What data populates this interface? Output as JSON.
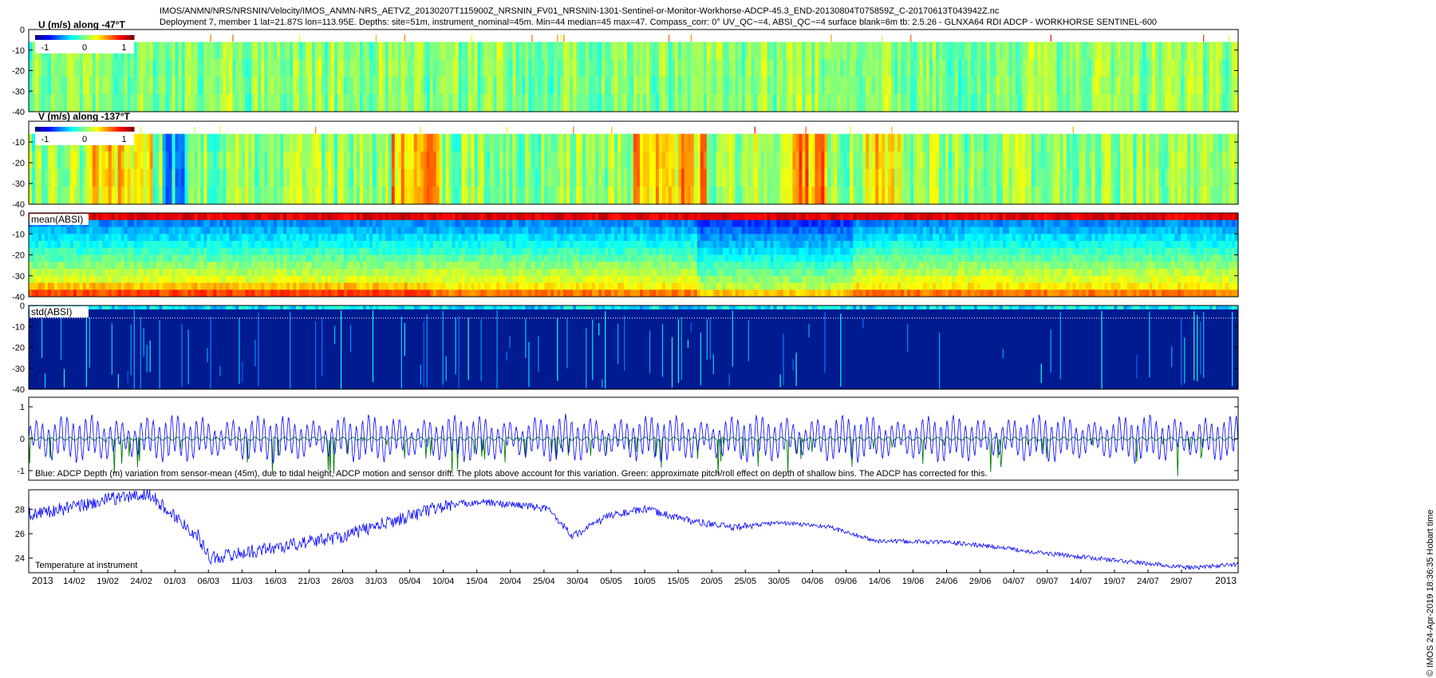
{
  "header": {
    "line1": "IMOS/ANMN/NRS/NRSNIN/Velocity/IMOS_ANMN-NRS_AETVZ_20130207T115900Z_NRSNIN_FV01_NRSNIN-1301-Sentinel-or-Monitor-Workhorse-ADCP-45.3_END-20130804T075859Z_C-20170613T043942Z.nc",
    "line2": "Deployment 7, member 1 lat=21.87S lon=113.95E. Depths: site=51m, instrument_nominal=45m. Min=44 median=45 max=47. Compass_corr: 0° UV_QC~=4, ABSI_QC~=4 surface blank=6m tb: 2.5.26 - GLNXA64 RDI ADCP - WORKHORSE SENTINEL-600"
  },
  "side_note": "© IMOS 24-Apr-2019 18:36:35 Hobart time",
  "colors": {
    "blue_line": "#0000ff",
    "green_line": "#007f00",
    "axis": "#000000"
  },
  "chart_data": [
    {
      "type": "heatmap",
      "id": "u",
      "title": "U (m/s) along -47°T",
      "colorbar": {
        "ticks": [
          "-1",
          "0",
          "1"
        ],
        "range": [
          -1.25,
          1.25
        ]
      },
      "ylim": [
        -40,
        0
      ],
      "yticks": [
        "0",
        "-10",
        "-20",
        "-30",
        "-40"
      ],
      "surface_blank_m": 6,
      "pattern": {
        "mean": 0.02,
        "noise": 0.22,
        "bands": []
      }
    },
    {
      "type": "heatmap",
      "id": "v",
      "title": "V (m/s) along -137°T",
      "colorbar": {
        "ticks": [
          "-1",
          "0",
          "1"
        ],
        "range": [
          -1.25,
          1.25
        ]
      },
      "ylim": [
        -40,
        0
      ],
      "yticks": [
        "-10",
        "-20",
        "-30",
        "-40"
      ],
      "surface_blank_m": 6,
      "pattern": {
        "mean": 0.05,
        "noise": 0.25,
        "bands": [
          [
            0.05,
            0.1,
            0.45
          ],
          [
            0.11,
            0.13,
            -0.7
          ],
          [
            0.3,
            0.34,
            0.55
          ],
          [
            0.5,
            0.56,
            0.5
          ],
          [
            0.63,
            0.66,
            0.7
          ],
          [
            0.69,
            0.72,
            0.4
          ]
        ]
      }
    },
    {
      "type": "heatmap",
      "id": "mean_absi",
      "title": "mean(ABSI)",
      "ylim": [
        -40,
        0
      ],
      "yticks": [
        "0",
        "-10",
        "-20",
        "-30",
        "-40"
      ],
      "surface_blank_m": 6
    },
    {
      "type": "heatmap",
      "id": "std_absi",
      "title": "std(ABSI)",
      "ylim": [
        -40,
        0
      ],
      "yticks": [
        "0",
        "-10",
        "-20",
        "-30",
        "-40"
      ],
      "surface_blank_m": 6
    },
    {
      "type": "line",
      "id": "depth",
      "annotation": "Blue: ADCP Depth (m) variation from sensor-mean (45m), due to tidal height, ADCP motion and sensor drift. The plots above account for this variation. Green: approximate pitch/roll effect on depth of shallow bins. The ADCP has corrected for this.",
      "ylim": [
        -1.3,
        1.3
      ],
      "yticks": [
        "1",
        "0",
        "-1"
      ],
      "yvals": [
        1,
        0,
        -1
      ],
      "series": [
        {
          "color": "#0000ff",
          "amplitude": 0.6
        },
        {
          "color": "#007f00",
          "amplitude": 0.3
        }
      ]
    },
    {
      "type": "line",
      "id": "temperature",
      "annotation": "Temperature at instrument",
      "ylim": [
        22.8,
        29.6
      ],
      "yticks": [
        "28",
        "26",
        "24"
      ],
      "yvals": [
        28,
        26,
        24
      ],
      "series": [
        {
          "color": "#0000ff",
          "knots": [
            [
              0,
              27.6
            ],
            [
              0.04,
              28.2
            ],
            [
              0.07,
              28.9
            ],
            [
              0.1,
              29.2
            ],
            [
              0.12,
              27.5
            ],
            [
              0.14,
              25.8
            ],
            [
              0.15,
              24.0
            ],
            [
              0.2,
              24.8
            ],
            [
              0.26,
              25.8
            ],
            [
              0.3,
              27.0
            ],
            [
              0.34,
              28.2
            ],
            [
              0.37,
              28.6
            ],
            [
              0.41,
              28.3
            ],
            [
              0.43,
              28.0
            ],
            [
              0.45,
              25.8
            ],
            [
              0.48,
              27.5
            ],
            [
              0.51,
              28.0
            ],
            [
              0.55,
              27.0
            ],
            [
              0.58,
              26.5
            ],
            [
              0.62,
              26.9
            ],
            [
              0.66,
              26.6
            ],
            [
              0.7,
              25.4
            ],
            [
              0.76,
              25.3
            ],
            [
              0.8,
              24.9
            ],
            [
              0.84,
              24.4
            ],
            [
              0.88,
              24.0
            ],
            [
              0.92,
              23.6
            ],
            [
              0.96,
              23.2
            ],
            [
              1,
              23.5
            ]
          ]
        }
      ]
    }
  ],
  "x_axis": {
    "year_start": "2013",
    "year_end": "2013",
    "ticks": [
      "14/02",
      "19/02",
      "24/02",
      "01/03",
      "06/03",
      "11/03",
      "16/03",
      "21/03",
      "26/03",
      "31/03",
      "05/04",
      "10/04",
      "15/04",
      "20/04",
      "25/04",
      "30/04",
      "05/05",
      "10/05",
      "15/05",
      "20/05",
      "25/05",
      "30/05",
      "04/06",
      "09/06",
      "14/06",
      "19/06",
      "24/06",
      "29/06",
      "04/07",
      "09/07",
      "14/07",
      "19/07",
      "24/07",
      "29/07"
    ]
  }
}
